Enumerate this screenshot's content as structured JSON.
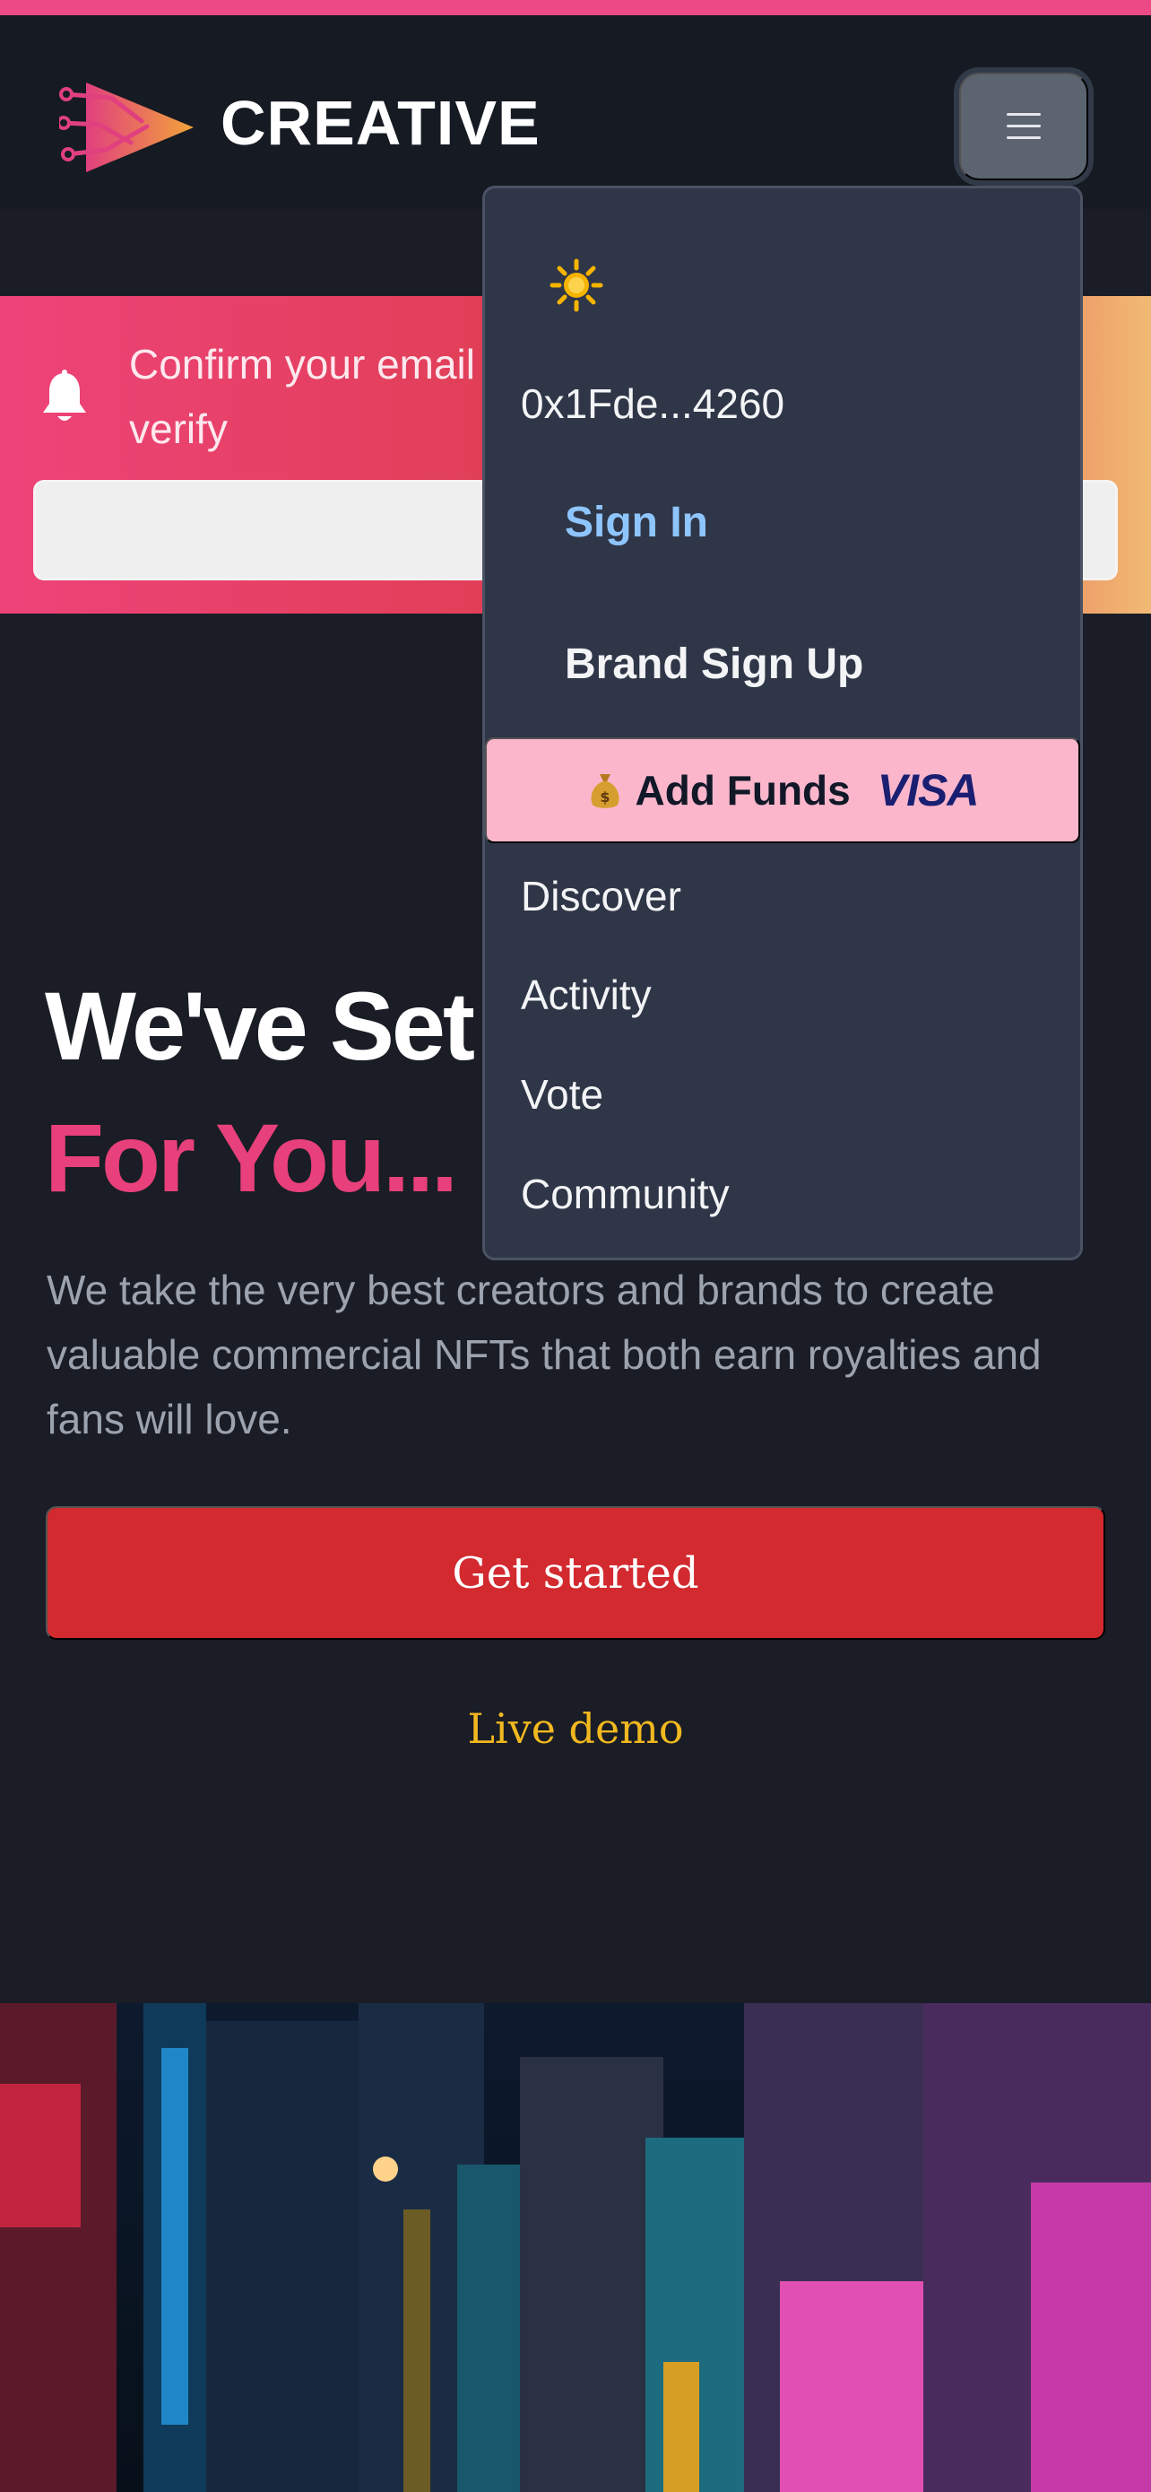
{
  "header": {
    "brand": "CREATIVE",
    "logo_icon": "play-logo-icon",
    "menu_icon": "hamburger-icon"
  },
  "banner": {
    "icon": "bell-icon",
    "text": "Confirm your email address to send a message to verify",
    "button_label": "Resend"
  },
  "hero": {
    "title_line1": "We've Set This Up",
    "title_line2": "For You...",
    "description": "We take the very best creators and brands to create valuable commercial NFTs that both earn royalties and fans will love.",
    "cta_label": "Get started",
    "demo_label": "Live demo"
  },
  "dropdown": {
    "theme_icon": "sun-icon",
    "wallet": "0x1Fde...4260",
    "sign_in": "Sign In",
    "brand_sign_up": "Brand Sign Up",
    "add_funds": "Add Funds",
    "add_funds_icon": "money-bag-icon",
    "visa": "VISA",
    "nav": [
      "Discover",
      "Activity",
      "Vote",
      "Community"
    ]
  },
  "colors": {
    "accent_pink": "#e8407a",
    "cta_red": "#d22a2f",
    "demo_gold": "#f2b81f",
    "link_blue": "#8ec5ff",
    "add_funds_bg": "#fbb6cc"
  }
}
